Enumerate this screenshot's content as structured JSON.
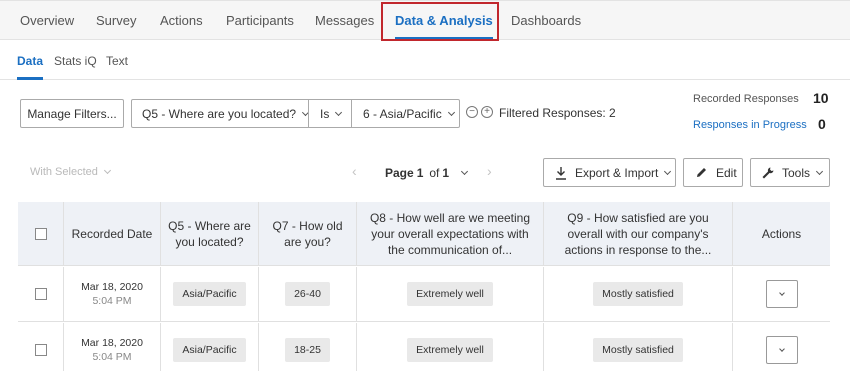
{
  "top_tabs": [
    "Overview",
    "Survey",
    "Actions",
    "Participants",
    "Messages",
    "Data & Analysis",
    "Dashboards"
  ],
  "active_top_tab": "Data & Analysis",
  "sub_tabs": [
    "Data",
    "Stats iQ",
    "Text"
  ],
  "active_sub_tab": "Data",
  "filters": {
    "manage_label": "Manage Filters...",
    "question_value": "Q5 - Where are you located?",
    "operator_value": "Is",
    "answer_value": "6 - Asia/Pacific",
    "filtered_label": "Filtered Responses: 2"
  },
  "stats": {
    "recorded_label": "Recorded Responses",
    "recorded_value": "10",
    "progress_label": "Responses in Progress",
    "progress_value": "0"
  },
  "toolbar": {
    "with_selected": "With Selected",
    "page_word": "Page",
    "page_current": "1",
    "page_of": "of",
    "page_total": "1",
    "export_label": "Export & Import",
    "edit_label": "Edit",
    "tools_label": "Tools"
  },
  "table": {
    "headers": [
      "Recorded Date",
      "Q5 - Where are you located?",
      "Q7 - How old are you?",
      "Q8 - How well are we meeting your overall expectations with the communication of...",
      "Q9 - How satisfied are you overall with our company's actions in response to the...",
      "Actions"
    ],
    "rows": [
      {
        "date": "Mar 18, 2020",
        "time": "5:04 PM",
        "location": "Asia/Pacific",
        "age": "26-40",
        "q8": "Extremely well",
        "q9": "Mostly satisfied"
      },
      {
        "date": "Mar 18, 2020",
        "time": "5:04 PM",
        "location": "Asia/Pacific",
        "age": "18-25",
        "q8": "Extremely well",
        "q9": "Mostly satisfied"
      }
    ]
  },
  "colors": {
    "accent": "#1b6fc2",
    "highlight": "#c1272d",
    "header_bg": "#eef1f6"
  }
}
